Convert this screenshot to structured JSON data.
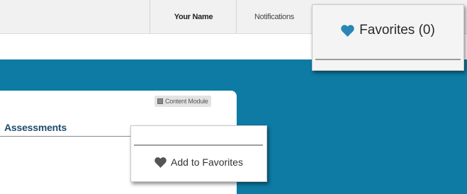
{
  "topbar": {
    "user_name": "Your Name",
    "notifications_label": "Notifications"
  },
  "favorites_popup": {
    "label": "Favorites (0)",
    "icon": "heart-icon",
    "icon_color": "#2a86b4"
  },
  "module": {
    "tag_label": "Content Module",
    "section_title": "Assessments"
  },
  "add_popup": {
    "label": "Add to Favorites",
    "icon": "heart-icon",
    "icon_color": "#555555"
  },
  "colors": {
    "accent": "#0d7ba3",
    "topbar": "#f1f1f1"
  }
}
